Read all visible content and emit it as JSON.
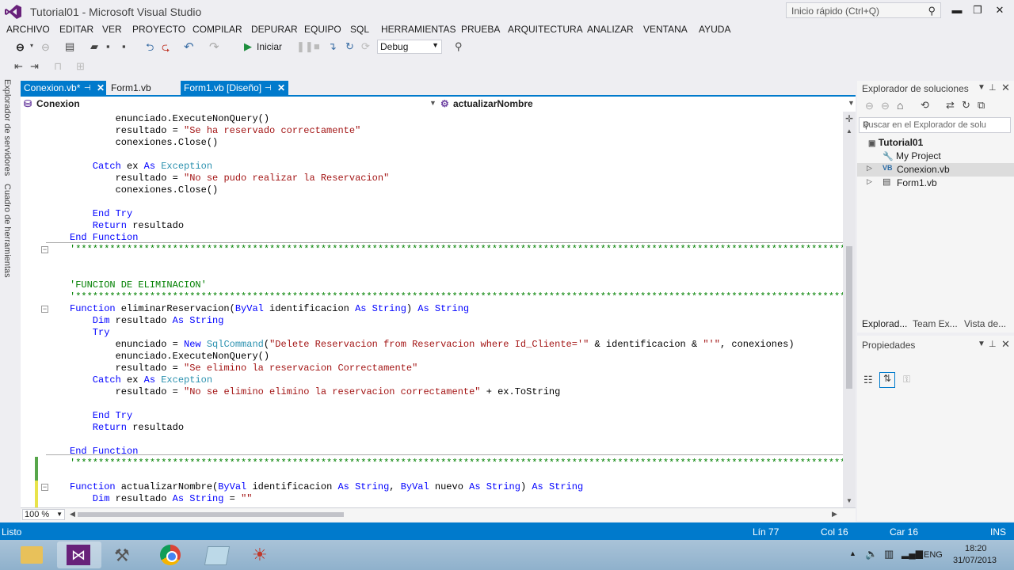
{
  "window": {
    "title": "Tutorial01 - Microsoft Visual Studio",
    "quick_launch_placeholder": "Inicio rápido (Ctrl+Q)"
  },
  "menu": [
    "ARCHIVO",
    "EDITAR",
    "VER",
    "PROYECTO",
    "COMPILAR",
    "DEPURAR",
    "EQUIPO",
    "SQL",
    "HERRAMIENTAS",
    "PRUEBA",
    "ARQUITECTURA",
    "ANALIZAR",
    "VENTANA",
    "AYUDA"
  ],
  "toolbar": {
    "start_label": "Iniciar",
    "config_value": "Debug"
  },
  "side_tabs": [
    "Explorador de servidores",
    "Cuadro de herramientas"
  ],
  "doc_tabs": [
    {
      "label": "Conexion.vb*",
      "active": true
    },
    {
      "label": "Form1.vb",
      "active": false
    },
    {
      "label": "Form1.vb [Diseño]",
      "active": true
    }
  ],
  "navbar": {
    "class_name": "Conexion",
    "member_name": "actualizarNombre"
  },
  "code_lines": [
    [
      [
        "tx",
        "        enunciado.ExecuteNonQuery()"
      ]
    ],
    [
      [
        "tx",
        "        resultado = "
      ],
      [
        "st",
        "\"Se ha reservado correctamente\""
      ]
    ],
    [
      [
        "tx",
        "        conexiones.Close()"
      ]
    ],
    [
      [
        "tx",
        ""
      ]
    ],
    [
      [
        "kw",
        "    Catch"
      ],
      [
        "tx",
        " ex "
      ],
      [
        "kw",
        "As"
      ],
      [
        "tx",
        " "
      ],
      [
        "ty",
        "Exception"
      ]
    ],
    [
      [
        "tx",
        "        resultado = "
      ],
      [
        "st",
        "\"No se pudo realizar la Reservacion\""
      ]
    ],
    [
      [
        "tx",
        "        conexiones.Close()"
      ]
    ],
    [
      [
        "tx",
        ""
      ]
    ],
    [
      [
        "kw",
        "    End Try"
      ]
    ],
    [
      [
        "kw",
        "    Return"
      ],
      [
        "tx",
        " resultado"
      ]
    ],
    [
      [
        "kw",
        "End Function"
      ]
    ],
    [
      [
        "cm",
        "'**************************************************************************************************************************************************************************************************"
      ]
    ],
    [
      [
        "tx",
        ""
      ]
    ],
    [
      [
        "tx",
        ""
      ]
    ],
    [
      [
        "cm",
        "'FUNCION DE ELIMINACION'"
      ]
    ],
    [
      [
        "cm",
        "'**************************************************************************************************************************************************************************************************"
      ]
    ],
    [
      [
        "kw",
        "Function"
      ],
      [
        "tx",
        " eliminarReservacion("
      ],
      [
        "kw",
        "ByVal"
      ],
      [
        "tx",
        " identificacion "
      ],
      [
        "kw",
        "As String"
      ],
      [
        "tx",
        ") "
      ],
      [
        "kw",
        "As String"
      ]
    ],
    [
      [
        "kw",
        "    Dim"
      ],
      [
        "tx",
        " resultado "
      ],
      [
        "kw",
        "As String"
      ]
    ],
    [
      [
        "kw",
        "    Try"
      ]
    ],
    [
      [
        "tx",
        "        enunciado = "
      ],
      [
        "kw",
        "New"
      ],
      [
        "tx",
        " "
      ],
      [
        "ty",
        "SqlCommand"
      ],
      [
        "tx",
        "("
      ],
      [
        "st",
        "\"Delete Reservacion from Reservacion where Id_Cliente='\""
      ],
      [
        "tx",
        " & identificacion & "
      ],
      [
        "st",
        "\"'\""
      ],
      [
        "tx",
        ", conexiones)"
      ]
    ],
    [
      [
        "tx",
        "        enunciado.ExecuteNonQuery()"
      ]
    ],
    [
      [
        "tx",
        "        resultado = "
      ],
      [
        "st",
        "\"Se elimino la reservacion Correctamente\""
      ]
    ],
    [
      [
        "kw",
        "    Catch"
      ],
      [
        "tx",
        " ex "
      ],
      [
        "kw",
        "As"
      ],
      [
        "tx",
        " "
      ],
      [
        "ty",
        "Exception"
      ]
    ],
    [
      [
        "tx",
        "        resultado = "
      ],
      [
        "st",
        "\"No se elimino elimino la reservacion correctamente\""
      ],
      [
        "tx",
        " + ex.ToString"
      ]
    ],
    [
      [
        "tx",
        ""
      ]
    ],
    [
      [
        "kw",
        "    End Try"
      ]
    ],
    [
      [
        "kw",
        "    Return"
      ],
      [
        "tx",
        " resultado"
      ]
    ],
    [
      [
        "tx",
        ""
      ]
    ],
    [
      [
        "kw",
        "End Function"
      ]
    ],
    [
      [
        "cm",
        "'**************************************************************************************************************************************************************************************************"
      ]
    ],
    [
      [
        "tx",
        ""
      ]
    ],
    [
      [
        "kw",
        "Function"
      ],
      [
        "tx",
        " actualizarNombre("
      ],
      [
        "kw",
        "ByVal"
      ],
      [
        "tx",
        " identificacion "
      ],
      [
        "kw",
        "As String"
      ],
      [
        "tx",
        ", "
      ],
      [
        "kw",
        "ByVal"
      ],
      [
        "tx",
        " nuevo "
      ],
      [
        "kw",
        "As String"
      ],
      [
        "tx",
        ") "
      ],
      [
        "kw",
        "As String"
      ]
    ],
    [
      [
        "kw",
        "    Dim"
      ],
      [
        "tx",
        " resultado "
      ],
      [
        "kw",
        "As String"
      ],
      [
        "tx",
        " = "
      ],
      [
        "st",
        "\"\""
      ]
    ]
  ],
  "editor": {
    "zoom": "100 %"
  },
  "solution_explorer": {
    "title": "Explorador de soluciones",
    "search_placeholder": "Buscar en el Explorador de solu",
    "items": [
      {
        "label": "Tutorial01",
        "icon": "solution-icon",
        "bold": true
      },
      {
        "label": "My Project",
        "icon": "wrench-icon"
      },
      {
        "label": "Conexion.vb",
        "icon": "vb-file-icon",
        "selected": true
      },
      {
        "label": "Form1.vb",
        "icon": "form-icon"
      }
    ],
    "bottom_tabs": [
      "Explorad...",
      "Team Ex...",
      "Vista de..."
    ]
  },
  "properties": {
    "title": "Propiedades"
  },
  "status": {
    "ready": "Listo",
    "line": "Lín 77",
    "col": "Col 16",
    "car": "Car 16",
    "mode": "INS"
  },
  "taskbar": {
    "lang": "ENG",
    "time": "18:20",
    "date": "31/07/2013"
  },
  "colors": {
    "accent": "#007acc",
    "keyword": "#0000ff",
    "type": "#2b91af",
    "string": "#a31515",
    "comment": "#008000"
  }
}
